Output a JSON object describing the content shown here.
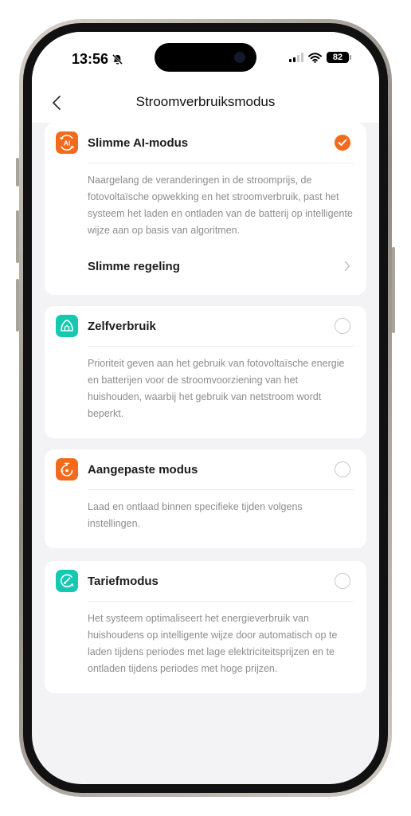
{
  "status_bar": {
    "time": "13:56",
    "battery": "82"
  },
  "nav": {
    "title": "Stroomverbruiksmodus"
  },
  "colors": {
    "accent": "#f26a1b",
    "teal": "#14c9b0"
  },
  "modes": [
    {
      "title": "Slimme AI-modus",
      "icon": "ai-mode-icon",
      "selected": true,
      "description": "Naargelang de veranderingen in de stroomprijs, de fotovoltaïsche opwekking en het stroomverbruik, past het systeem het laden en ontladen van de batterij op intelligente wijze aan op basis van algoritmen.",
      "sub_item": "Slimme regeling"
    },
    {
      "title": "Zelfverbruik",
      "icon": "leaf-house-icon",
      "selected": false,
      "description": "Prioriteit geven aan het gebruik van fotovoltaïsche energie en batterijen voor de stroomvoorziening van het huishouden, waarbij het gebruik van netstroom wordt beperkt."
    },
    {
      "title": "Aangepaste modus",
      "icon": "timer-icon",
      "selected": false,
      "description": "Laad en ontlaad binnen specifieke tijden volgens instellingen."
    },
    {
      "title": "Tariefmodus",
      "icon": "tariff-gauge-icon",
      "selected": false,
      "description": "Het systeem optimaliseert het energieverbruik van huishoudens op intelligente wijze door automatisch op te laden tijdens periodes met lage elektriciteitsprijzen en te ontladen tijdens periodes met hoge prijzen."
    }
  ]
}
